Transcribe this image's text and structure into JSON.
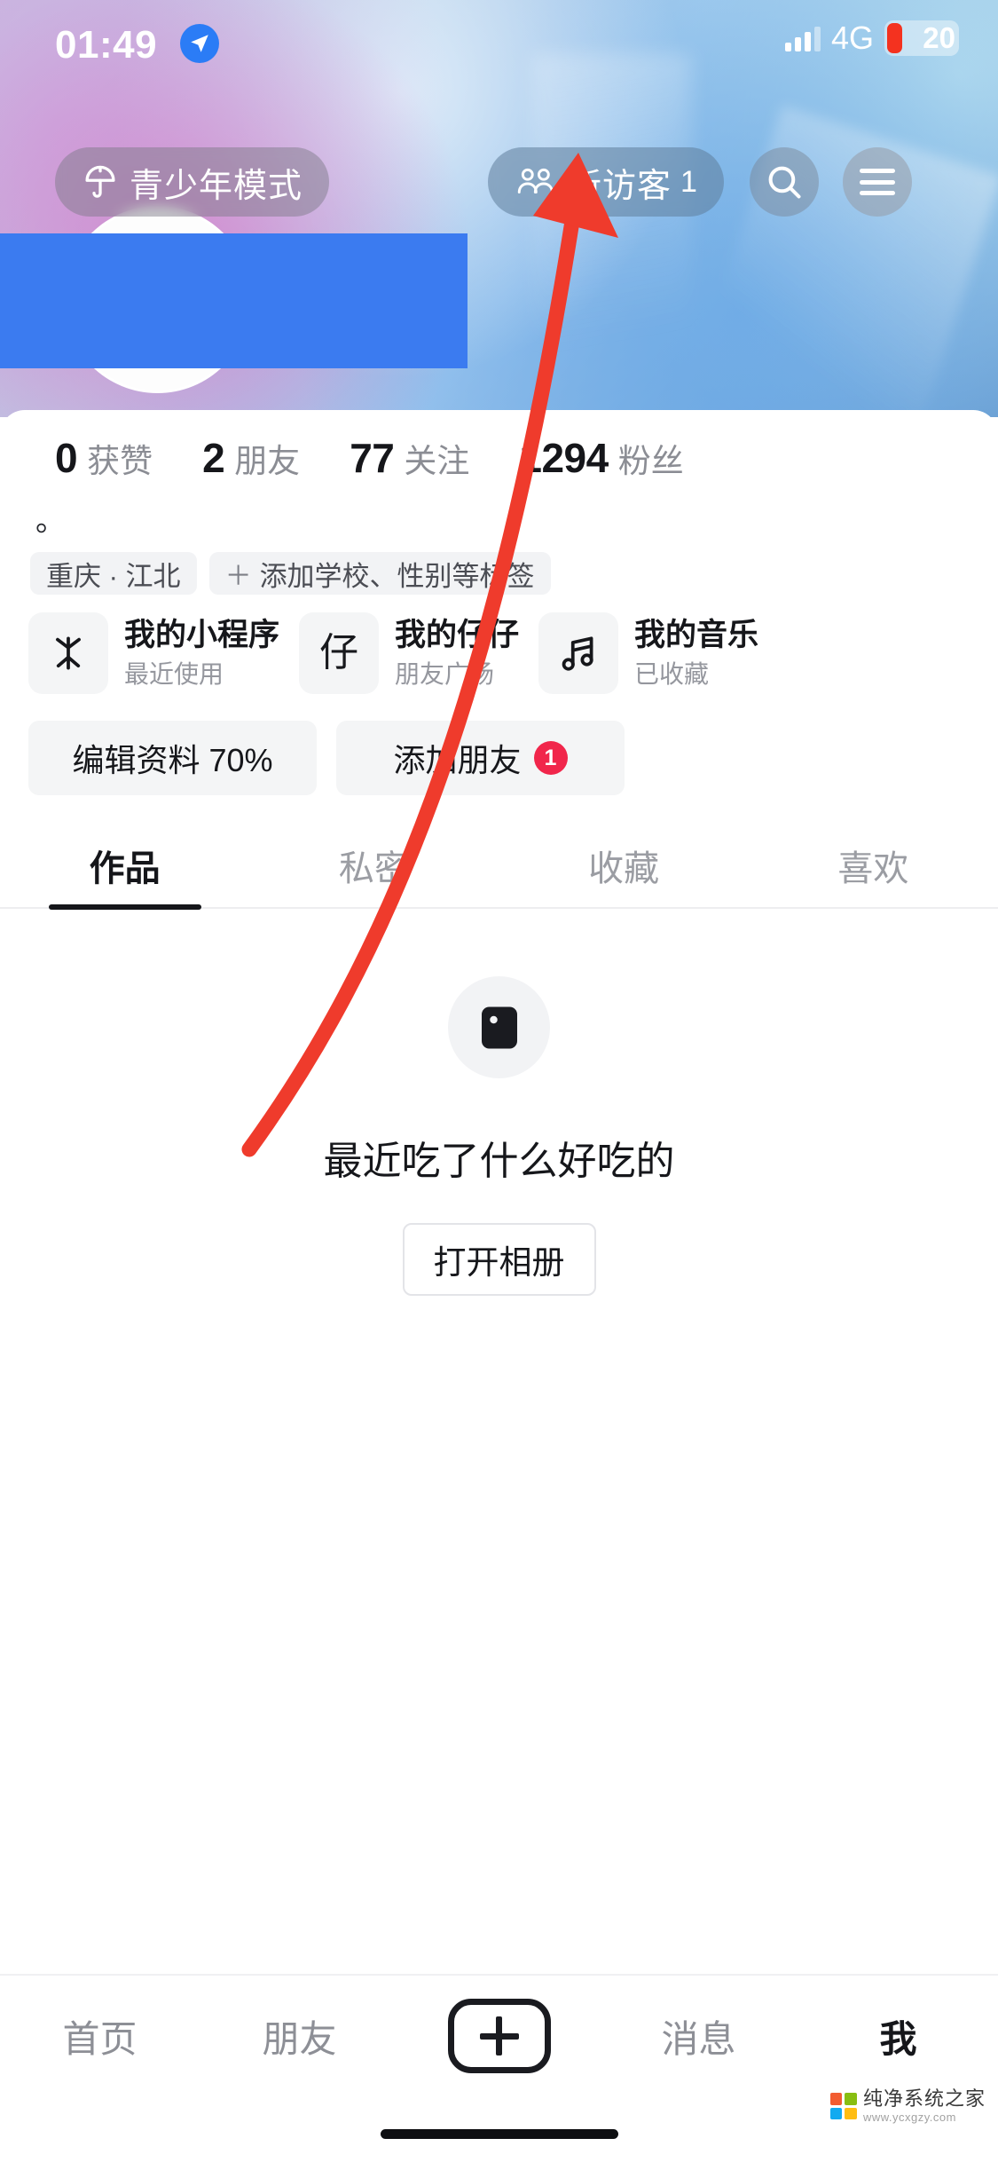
{
  "status_bar": {
    "time": "01:49",
    "location_icon": "location-arrow-icon",
    "signal_icon": "signal-bars-icon",
    "network": "4G",
    "battery_percent": "20",
    "battery_color": "#f4321f"
  },
  "header": {
    "teen_mode": {
      "label": "青少年模式",
      "icon": "umbrella-icon"
    },
    "visitor": {
      "label": "新访客",
      "count": "1",
      "icon": "people-icon"
    },
    "search_icon": "search-icon",
    "menu_icon": "hamburger-menu-icon"
  },
  "redaction": {
    "color": "#3b7bf0"
  },
  "profile": {
    "stats": [
      {
        "value": "0",
        "label": "获赞"
      },
      {
        "value": "2",
        "label": "朋友"
      },
      {
        "value": "77",
        "label": "关注"
      },
      {
        "value": "1294",
        "label": "粉丝"
      }
    ],
    "bio": "。",
    "tags": [
      {
        "label": "重庆 · 江北",
        "has_plus": false
      },
      {
        "label": "添加学校、性别等标签",
        "has_plus": true
      }
    ],
    "cards": [
      {
        "title": "我的小程序",
        "subtitle": "最近使用",
        "icon": "mini-program-icon"
      },
      {
        "title": "我的仔仔",
        "subtitle": "朋友广场",
        "icon": "zai-glyph-icon",
        "glyph": "仔"
      },
      {
        "title": "我的音乐",
        "subtitle": "已收藏",
        "icon": "music-note-icon"
      }
    ],
    "actions": [
      {
        "label": "编辑资料 70%",
        "badge": ""
      },
      {
        "label": "添加朋友",
        "badge": "1"
      }
    ]
  },
  "tabs": [
    {
      "label": "作品",
      "active": true
    },
    {
      "label": "私密",
      "active": false
    },
    {
      "label": "收藏",
      "active": false
    },
    {
      "label": "喜欢",
      "active": false
    }
  ],
  "empty_state": {
    "icon": "image-placeholder-icon",
    "title": "最近吃了什么好吃的",
    "button_label": "打开相册"
  },
  "bottom_nav": [
    {
      "label": "首页",
      "active": false
    },
    {
      "label": "朋友",
      "active": false
    },
    {
      "label": "",
      "active": false,
      "icon": "plus-square-icon"
    },
    {
      "label": "消息",
      "active": false
    },
    {
      "label": "我",
      "active": true
    }
  ],
  "annotation": {
    "arrow_color": "#ef3b2c"
  },
  "watermark": {
    "line1": "纯净系统之家",
    "line2": "www.ycxgzy.com"
  }
}
